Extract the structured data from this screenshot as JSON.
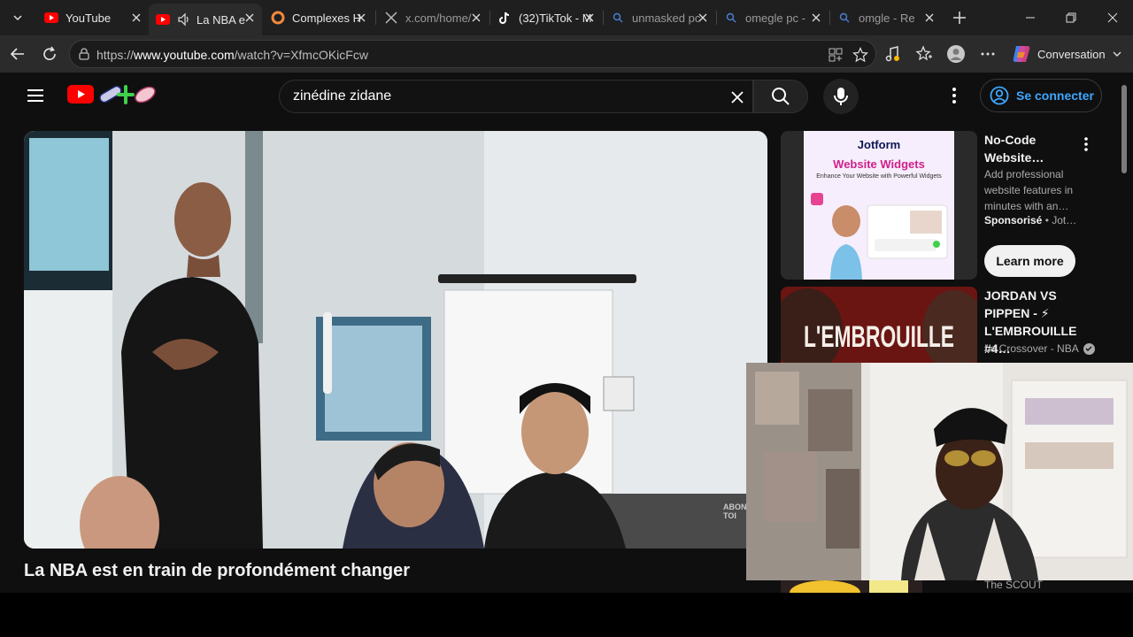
{
  "browser": {
    "tabs": [
      {
        "label": "YouTube",
        "favicon": "youtube-icon",
        "state": "normal"
      },
      {
        "label": "La NBA e",
        "favicon": "youtube-icon",
        "state": "active",
        "audio": "speaker-icon"
      },
      {
        "label": "Complexes H",
        "favicon": "ring-icon",
        "state": "normal"
      },
      {
        "label": "x.com/home/",
        "favicon": "x-icon",
        "state": "dim"
      },
      {
        "label": "(32)TikTok - M",
        "favicon": "tiktok-icon",
        "state": "normal"
      },
      {
        "label": "unmasked pc",
        "favicon": "search-icon",
        "state": "dim"
      },
      {
        "label": "omegle pc - ",
        "favicon": "search-icon",
        "state": "dim"
      },
      {
        "label": "omgle - Re",
        "favicon": "search-icon",
        "state": "dim"
      }
    ],
    "url_prefix": "https://",
    "url_domain": "www.youtube.com",
    "url_path": "/watch?v=XfmcOKicFcw",
    "copilot_label": "Conversation"
  },
  "youtube": {
    "search_query": "zinédine zidane",
    "signin_label": "Se connecter",
    "video_title": "La NBA est en train de profondément changer",
    "ad": {
      "brand": "Jotform",
      "headline": "Website Widgets",
      "subline": "Enhance Your Website with Powerful Widgets",
      "title": "No-Code Website…",
      "description": "Add professional website features in minutes with an…",
      "sponsored": "Sponsorisé",
      "advertiser": " • Jot…",
      "cta": "Learn more"
    },
    "recommendation": {
      "title": "JORDAN VS PIPPEN - ⚡ L'EMBROUILLE #4…",
      "thumb_text": "L'EMBROUILLE",
      "channel": "Le Crossover - NBA"
    },
    "recommendation2": {
      "channel": "The SCOUT"
    }
  },
  "colors": {
    "youtube_red": "#ff0000",
    "link_blue": "#3ea6ff",
    "page_bg": "#0f0f0f"
  }
}
